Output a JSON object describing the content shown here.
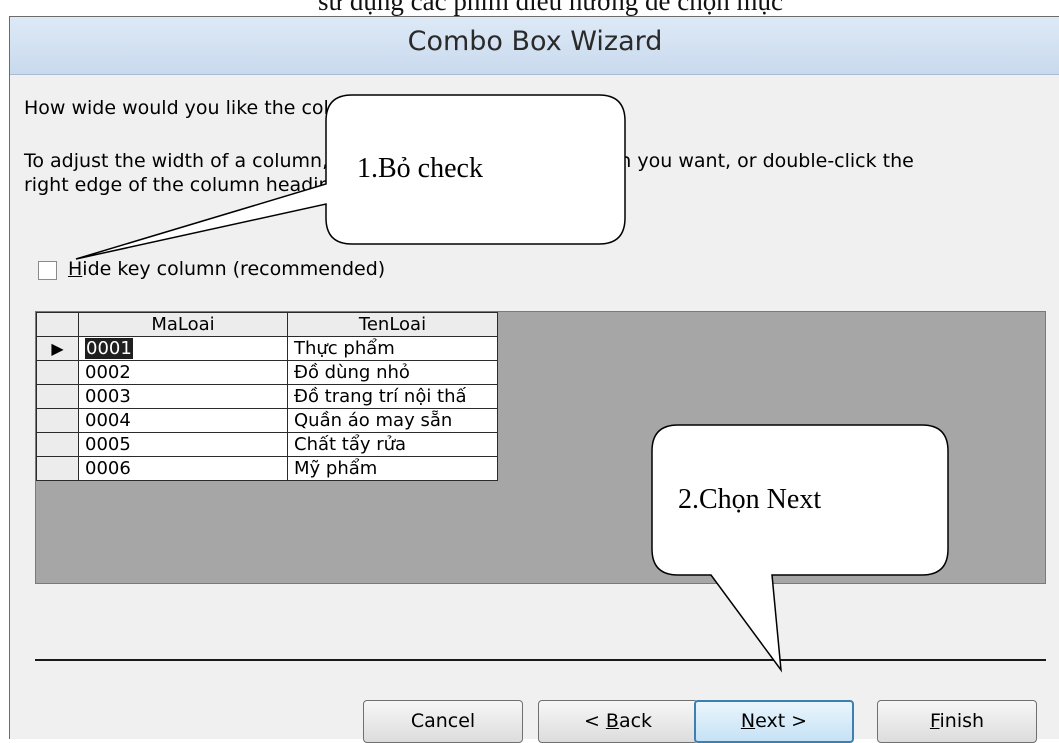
{
  "top_cropped_text": "sử dụng các phím điều hướng để chọn mục",
  "window": {
    "title": "Combo Box Wizard"
  },
  "content": {
    "question": "How wide would you like the columns in your combo box?",
    "instruction_line1": "To adjust the width of a column, drag its right edge to the width you want, or double-click the",
    "instruction_line2": "right edge of the column heading to get the best fit."
  },
  "checkbox": {
    "label_hotkey": "H",
    "label_rest": "ide key column (recommended)",
    "checked": false
  },
  "grid": {
    "columns": [
      "MaLoai",
      "TenLoai"
    ],
    "current_row_marker": "▶",
    "rows": [
      {
        "ma": "0001",
        "ten": "Thực phẩm",
        "current": true
      },
      {
        "ma": "0002",
        "ten": "Đồ dùng nhỏ",
        "current": false
      },
      {
        "ma": "0003",
        "ten": "Đồ trang trí nội thấ",
        "current": false
      },
      {
        "ma": "0004",
        "ten": "Quần áo may sẵn",
        "current": false
      },
      {
        "ma": "0005",
        "ten": "Chất tẩy rửa",
        "current": false
      },
      {
        "ma": "0006",
        "ten": "Mỹ phẩm",
        "current": false
      }
    ]
  },
  "buttons": {
    "cancel": "Cancel",
    "back_prefix": "< ",
    "back_hotkey": "B",
    "back_rest": "ack",
    "next_hotkey": "N",
    "next_rest": "ext >",
    "finish_hotkey": "F",
    "finish_rest": "inish"
  },
  "callouts": {
    "first": "1.Bỏ check",
    "second": "2.Chọn Next"
  }
}
